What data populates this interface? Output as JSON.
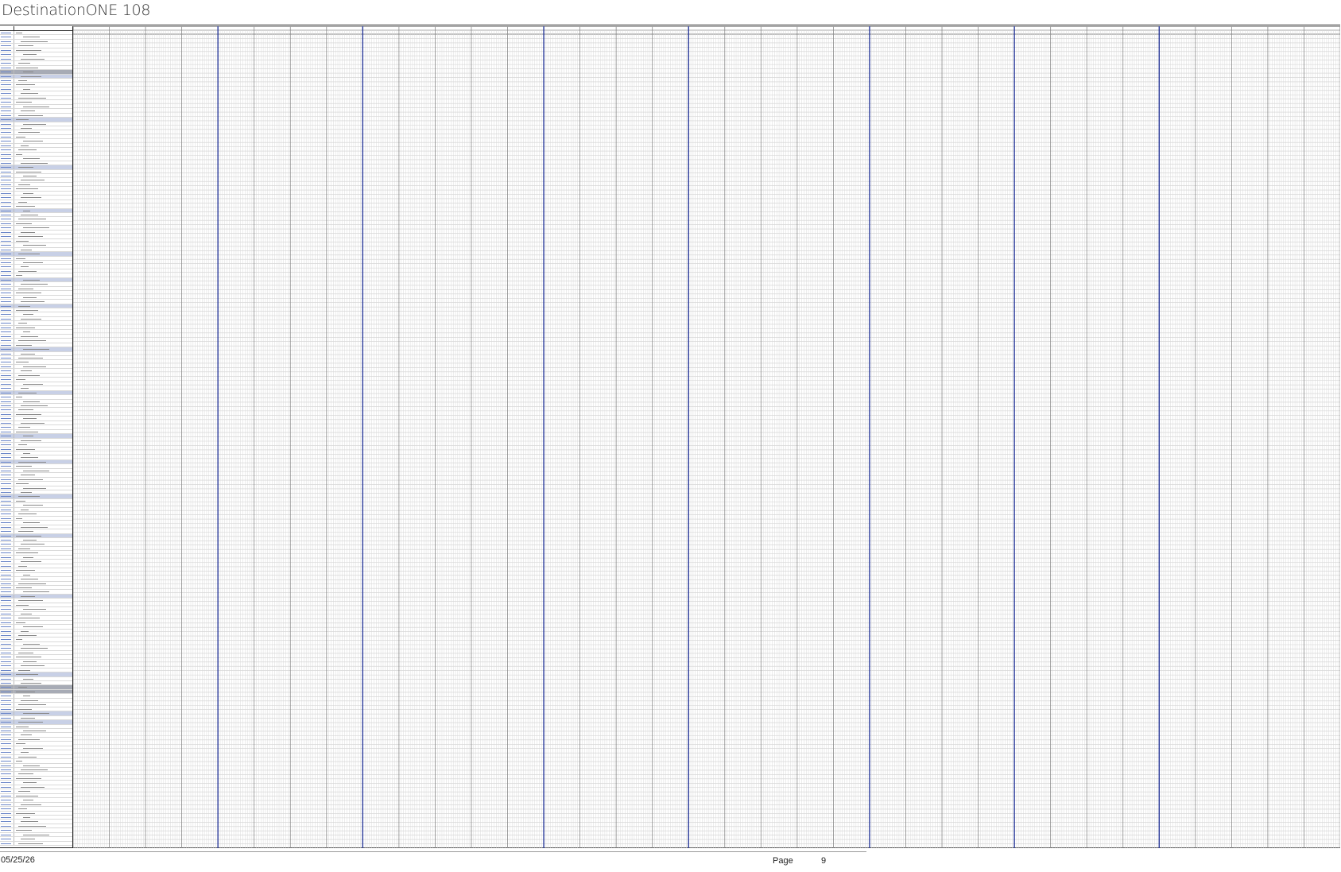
{
  "document": {
    "title": "DestinationONE 108"
  },
  "footer": {
    "date": "05/25/26",
    "page_label": "Page",
    "page_number": "9"
  },
  "colors": {
    "section_band": "#c8d0e6",
    "section_band_dark": "#a7abb5",
    "group_divider": "#2a3a9a",
    "grid_line": "#cfcfcf",
    "text": "#222222"
  },
  "sheet": {
    "row_count": 188,
    "column_groups": 35,
    "columns_per_group": 16,
    "section_rows": [
      9,
      10,
      20,
      31,
      41,
      51,
      57,
      63,
      73,
      83,
      93,
      99,
      107,
      116,
      130,
      148,
      157,
      159,
      189
    ],
    "dark_section_rows": [
      9,
      151,
      152
    ],
    "divider_groups": [
      4,
      8,
      13,
      17,
      22,
      26,
      30
    ]
  }
}
